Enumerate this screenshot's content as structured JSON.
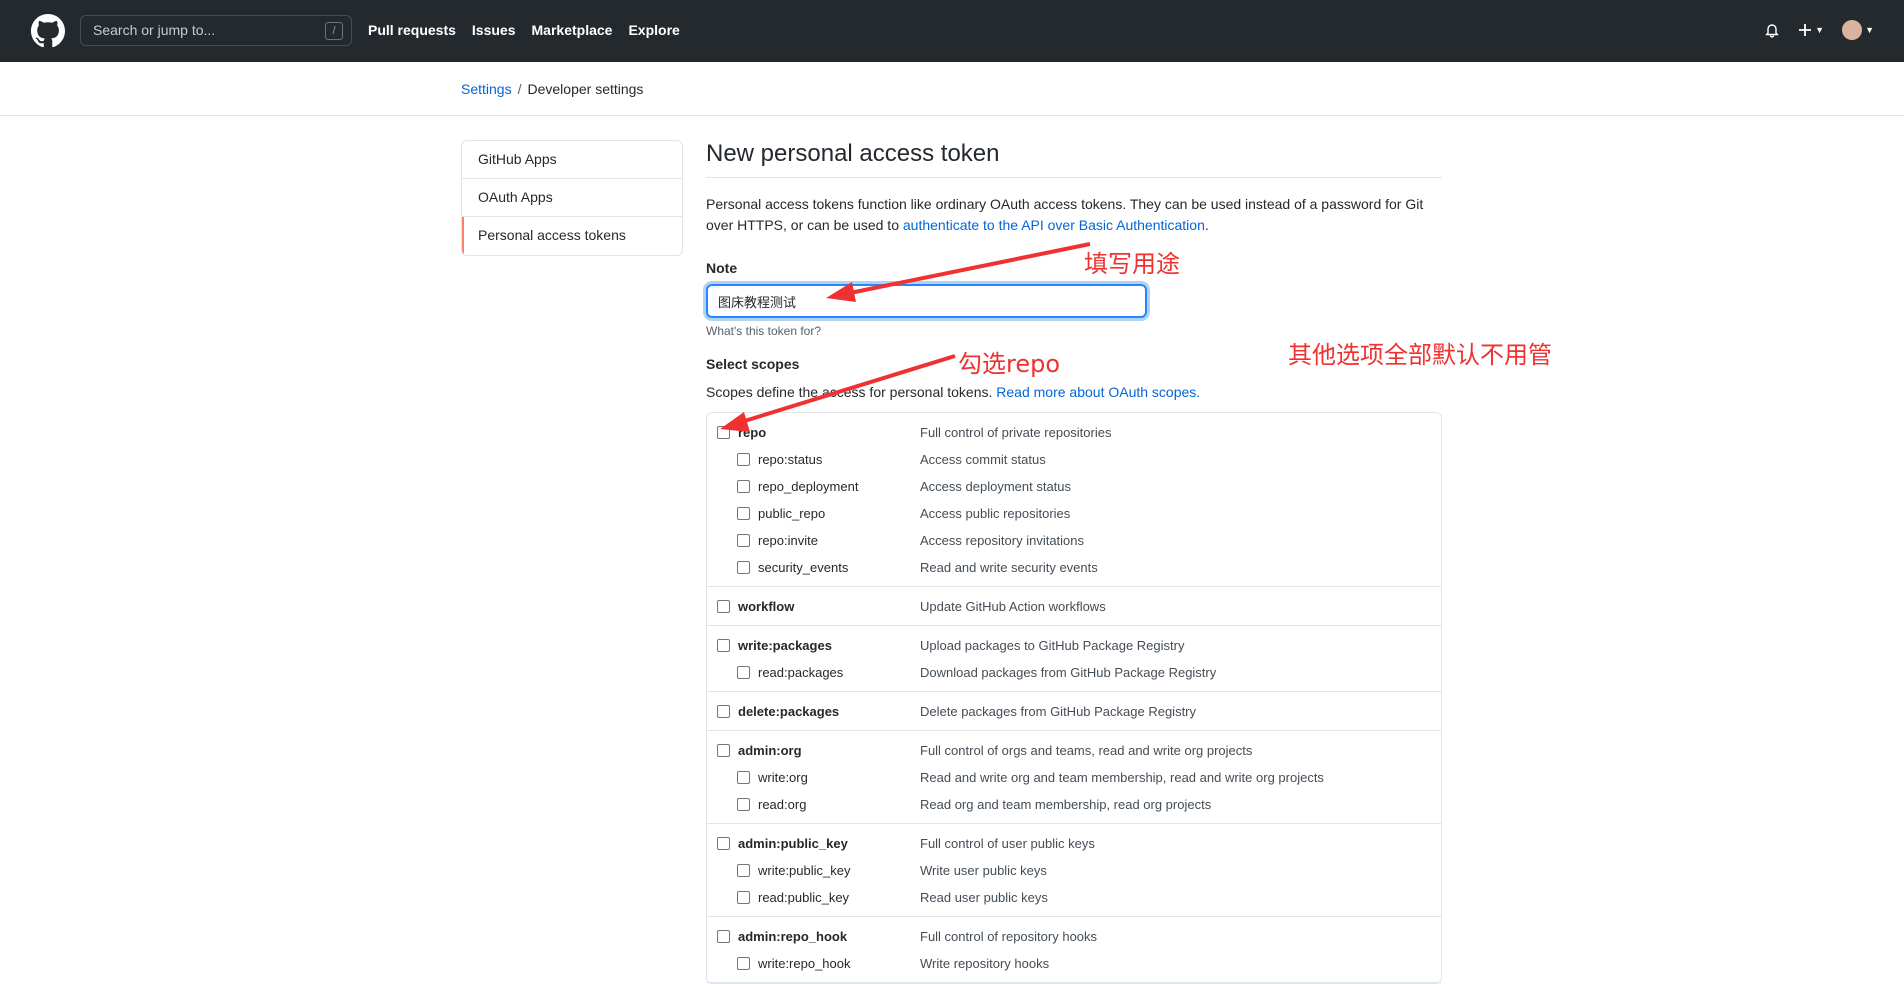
{
  "header": {
    "search_placeholder": "Search or jump to...",
    "slash_key": "/",
    "nav": [
      "Pull requests",
      "Issues",
      "Marketplace",
      "Explore"
    ]
  },
  "breadcrumb": {
    "settings": "Settings",
    "separator": "/",
    "current": "Developer settings"
  },
  "sidebar": {
    "items": [
      "GitHub Apps",
      "OAuth Apps",
      "Personal access tokens"
    ]
  },
  "page": {
    "title": "New personal access token",
    "description_1": "Personal access tokens function like ordinary OAuth access tokens. They can be used instead of a password for Git over HTTPS, or can be used to ",
    "description_link": "authenticate to the API over Basic Authentication",
    "description_end": ".",
    "note_label": "Note",
    "note_value": "图床教程测试",
    "note_hint": "What's this token for?",
    "scopes_label": "Select scopes",
    "scopes_desc": "Scopes define the access for personal tokens. ",
    "scopes_link": "Read more about OAuth scopes."
  },
  "scopes": [
    {
      "name": "repo",
      "desc": "Full control of private repositories",
      "subs": [
        {
          "name": "repo:status",
          "desc": "Access commit status"
        },
        {
          "name": "repo_deployment",
          "desc": "Access deployment status"
        },
        {
          "name": "public_repo",
          "desc": "Access public repositories"
        },
        {
          "name": "repo:invite",
          "desc": "Access repository invitations"
        },
        {
          "name": "security_events",
          "desc": "Read and write security events"
        }
      ]
    },
    {
      "name": "workflow",
      "desc": "Update GitHub Action workflows",
      "subs": []
    },
    {
      "name": "write:packages",
      "desc": "Upload packages to GitHub Package Registry",
      "subs": [
        {
          "name": "read:packages",
          "desc": "Download packages from GitHub Package Registry"
        }
      ]
    },
    {
      "name": "delete:packages",
      "desc": "Delete packages from GitHub Package Registry",
      "subs": []
    },
    {
      "name": "admin:org",
      "desc": "Full control of orgs and teams, read and write org projects",
      "subs": [
        {
          "name": "write:org",
          "desc": "Read and write org and team membership, read and write org projects"
        },
        {
          "name": "read:org",
          "desc": "Read org and team membership, read org projects"
        }
      ]
    },
    {
      "name": "admin:public_key",
      "desc": "Full control of user public keys",
      "subs": [
        {
          "name": "write:public_key",
          "desc": "Write user public keys"
        },
        {
          "name": "read:public_key",
          "desc": "Read user public keys"
        }
      ]
    },
    {
      "name": "admin:repo_hook",
      "desc": "Full control of repository hooks",
      "subs": [
        {
          "name": "write:repo_hook",
          "desc": "Write repository hooks"
        }
      ]
    }
  ],
  "annotations": {
    "fill_purpose": "填写用途",
    "check_repo": "勾选repo",
    "others_default": "其他选项全部默认不用管",
    "color": "#ef3131"
  }
}
